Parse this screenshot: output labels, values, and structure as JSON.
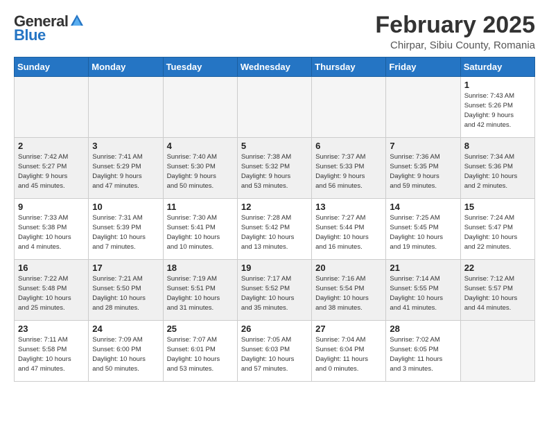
{
  "logo": {
    "general": "General",
    "blue": "Blue"
  },
  "title": {
    "month_year": "February 2025",
    "location": "Chirpar, Sibiu County, Romania"
  },
  "weekdays": [
    "Sunday",
    "Monday",
    "Tuesday",
    "Wednesday",
    "Thursday",
    "Friday",
    "Saturday"
  ],
  "weeks": [
    [
      {
        "day": null,
        "info": null
      },
      {
        "day": null,
        "info": null
      },
      {
        "day": null,
        "info": null
      },
      {
        "day": null,
        "info": null
      },
      {
        "day": null,
        "info": null
      },
      {
        "day": null,
        "info": null
      },
      {
        "day": "1",
        "info": "Sunrise: 7:43 AM\nSunset: 5:26 PM\nDaylight: 9 hours\nand 42 minutes."
      }
    ],
    [
      {
        "day": "2",
        "info": "Sunrise: 7:42 AM\nSunset: 5:27 PM\nDaylight: 9 hours\nand 45 minutes."
      },
      {
        "day": "3",
        "info": "Sunrise: 7:41 AM\nSunset: 5:29 PM\nDaylight: 9 hours\nand 47 minutes."
      },
      {
        "day": "4",
        "info": "Sunrise: 7:40 AM\nSunset: 5:30 PM\nDaylight: 9 hours\nand 50 minutes."
      },
      {
        "day": "5",
        "info": "Sunrise: 7:38 AM\nSunset: 5:32 PM\nDaylight: 9 hours\nand 53 minutes."
      },
      {
        "day": "6",
        "info": "Sunrise: 7:37 AM\nSunset: 5:33 PM\nDaylight: 9 hours\nand 56 minutes."
      },
      {
        "day": "7",
        "info": "Sunrise: 7:36 AM\nSunset: 5:35 PM\nDaylight: 9 hours\nand 59 minutes."
      },
      {
        "day": "8",
        "info": "Sunrise: 7:34 AM\nSunset: 5:36 PM\nDaylight: 10 hours\nand 2 minutes."
      }
    ],
    [
      {
        "day": "9",
        "info": "Sunrise: 7:33 AM\nSunset: 5:38 PM\nDaylight: 10 hours\nand 4 minutes."
      },
      {
        "day": "10",
        "info": "Sunrise: 7:31 AM\nSunset: 5:39 PM\nDaylight: 10 hours\nand 7 minutes."
      },
      {
        "day": "11",
        "info": "Sunrise: 7:30 AM\nSunset: 5:41 PM\nDaylight: 10 hours\nand 10 minutes."
      },
      {
        "day": "12",
        "info": "Sunrise: 7:28 AM\nSunset: 5:42 PM\nDaylight: 10 hours\nand 13 minutes."
      },
      {
        "day": "13",
        "info": "Sunrise: 7:27 AM\nSunset: 5:44 PM\nDaylight: 10 hours\nand 16 minutes."
      },
      {
        "day": "14",
        "info": "Sunrise: 7:25 AM\nSunset: 5:45 PM\nDaylight: 10 hours\nand 19 minutes."
      },
      {
        "day": "15",
        "info": "Sunrise: 7:24 AM\nSunset: 5:47 PM\nDaylight: 10 hours\nand 22 minutes."
      }
    ],
    [
      {
        "day": "16",
        "info": "Sunrise: 7:22 AM\nSunset: 5:48 PM\nDaylight: 10 hours\nand 25 minutes."
      },
      {
        "day": "17",
        "info": "Sunrise: 7:21 AM\nSunset: 5:50 PM\nDaylight: 10 hours\nand 28 minutes."
      },
      {
        "day": "18",
        "info": "Sunrise: 7:19 AM\nSunset: 5:51 PM\nDaylight: 10 hours\nand 31 minutes."
      },
      {
        "day": "19",
        "info": "Sunrise: 7:17 AM\nSunset: 5:52 PM\nDaylight: 10 hours\nand 35 minutes."
      },
      {
        "day": "20",
        "info": "Sunrise: 7:16 AM\nSunset: 5:54 PM\nDaylight: 10 hours\nand 38 minutes."
      },
      {
        "day": "21",
        "info": "Sunrise: 7:14 AM\nSunset: 5:55 PM\nDaylight: 10 hours\nand 41 minutes."
      },
      {
        "day": "22",
        "info": "Sunrise: 7:12 AM\nSunset: 5:57 PM\nDaylight: 10 hours\nand 44 minutes."
      }
    ],
    [
      {
        "day": "23",
        "info": "Sunrise: 7:11 AM\nSunset: 5:58 PM\nDaylight: 10 hours\nand 47 minutes."
      },
      {
        "day": "24",
        "info": "Sunrise: 7:09 AM\nSunset: 6:00 PM\nDaylight: 10 hours\nand 50 minutes."
      },
      {
        "day": "25",
        "info": "Sunrise: 7:07 AM\nSunset: 6:01 PM\nDaylight: 10 hours\nand 53 minutes."
      },
      {
        "day": "26",
        "info": "Sunrise: 7:05 AM\nSunset: 6:03 PM\nDaylight: 10 hours\nand 57 minutes."
      },
      {
        "day": "27",
        "info": "Sunrise: 7:04 AM\nSunset: 6:04 PM\nDaylight: 11 hours\nand 0 minutes."
      },
      {
        "day": "28",
        "info": "Sunrise: 7:02 AM\nSunset: 6:05 PM\nDaylight: 11 hours\nand 3 minutes."
      },
      {
        "day": null,
        "info": null
      }
    ]
  ]
}
